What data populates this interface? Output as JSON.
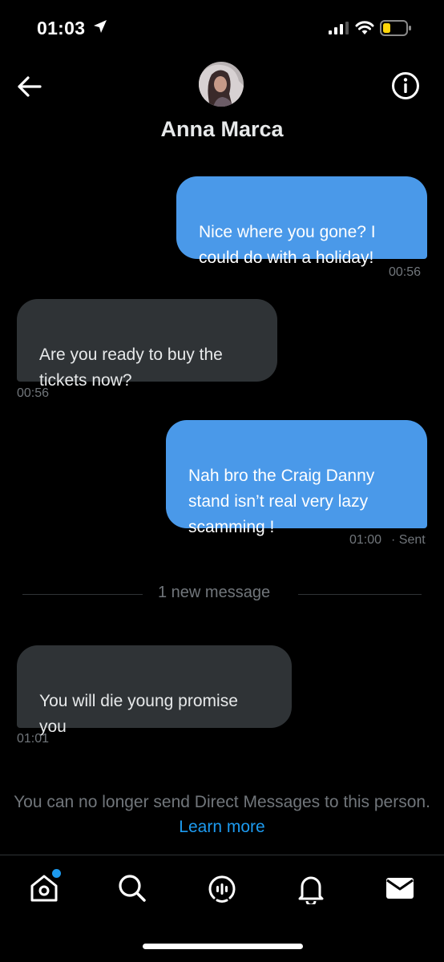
{
  "status_bar": {
    "time": "01:03"
  },
  "header": {
    "contact_name": "Anna Marca"
  },
  "messages": [
    {
      "direction": "out",
      "text": "Nice where you gone? I\ncould do with a holiday!",
      "time": "00:56"
    },
    {
      "direction": "in",
      "text": "Are you ready to buy the\ntickets now?",
      "time": "00:56"
    },
    {
      "direction": "out",
      "text": "Nah bro the Craig Danny\nstand isn’t real very lazy\nscamming !",
      "time": "01:00",
      "status": "· Sent"
    },
    {
      "direction": "in",
      "text": "You will die young promise\nyou",
      "time": "01:01"
    }
  ],
  "divider": {
    "label": "1 new message"
  },
  "notice": {
    "text": "You can no longer send Direct Messages to this person.",
    "link": "Learn more"
  },
  "tabs": [
    {
      "icon": "home-icon"
    },
    {
      "icon": "search-icon"
    },
    {
      "icon": "spaces-icon"
    },
    {
      "icon": "bell-icon"
    },
    {
      "icon": "mail-icon"
    }
  ],
  "colors": {
    "accent": "#1d9bf0",
    "outgoing_bubble": "#4a99e9",
    "incoming_bubble": "#2f3336",
    "battery": "#ffd60a"
  }
}
